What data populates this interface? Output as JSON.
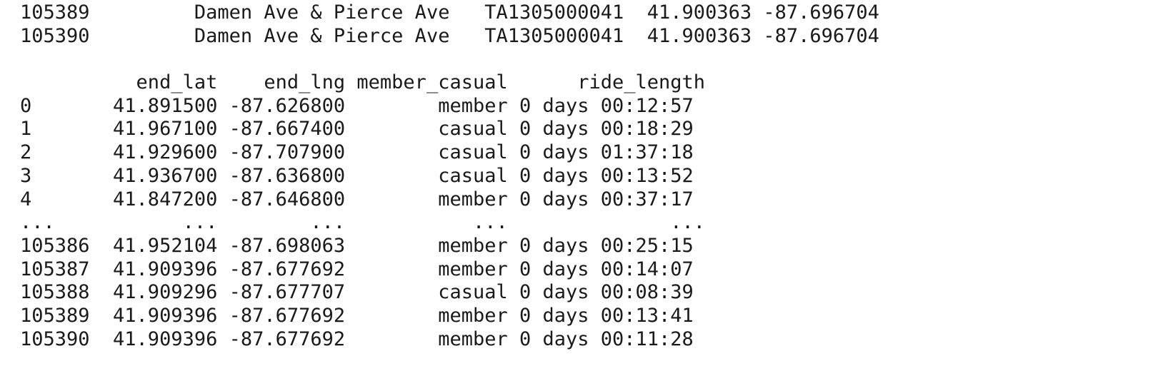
{
  "output": {
    "top_rows": [
      "105389         Damen Ave & Pierce Ave   TA1305000041  41.900363 -87.696704",
      "105390         Damen Ave & Pierce Ave   TA1305000041  41.900363 -87.696704"
    ],
    "header": "          end_lat    end_lng member_casual      ride_length",
    "rows": [
      "0       41.891500 -87.626800        member 0 days 00:12:57",
      "1       41.967100 -87.667400        casual 0 days 00:18:29",
      "2       41.929600 -87.707900        casual 0 days 01:37:18",
      "3       41.936700 -87.636800        casual 0 days 00:13:52",
      "4       41.847200 -87.646800        member 0 days 00:37:17",
      "...           ...        ...           ...              ...",
      "105386  41.952104 -87.698063        member 0 days 00:25:15",
      "105387  41.909396 -87.677692        member 0 days 00:14:07",
      "105388  41.909296 -87.677707        casual 0 days 00:08:39",
      "105389  41.909396 -87.677692        member 0 days 00:13:41",
      "105390  41.909396 -87.677692        member 0 days 00:11:28"
    ]
  }
}
